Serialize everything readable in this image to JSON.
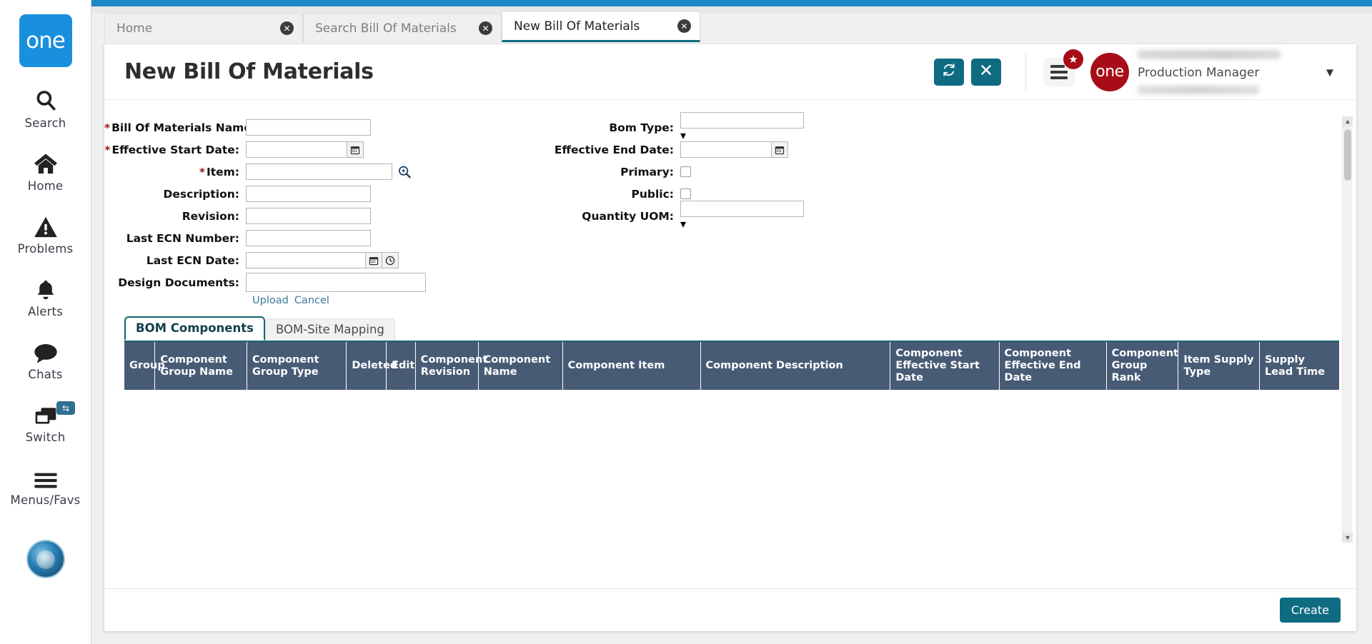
{
  "rail": {
    "logo_text": "one",
    "items": [
      {
        "label": "Search",
        "icon": "search-icon"
      },
      {
        "label": "Home",
        "icon": "home-icon"
      },
      {
        "label": "Problems",
        "icon": "warning-icon"
      },
      {
        "label": "Alerts",
        "icon": "bell-icon"
      },
      {
        "label": "Chats",
        "icon": "chat-bubble-icon"
      },
      {
        "label": "Switch",
        "icon": "switch-windows-icon",
        "badge_icon": "swap-arrows-icon"
      },
      {
        "label": "Menus/Favs",
        "icon": "hamburger-icon"
      }
    ]
  },
  "tabs": [
    {
      "label": "Home",
      "active": false
    },
    {
      "label": "Search Bill Of Materials",
      "active": false
    },
    {
      "label": "New Bill Of Materials",
      "active": true
    }
  ],
  "header": {
    "title": "New Bill Of Materials",
    "refresh_icon": "refresh-icon",
    "close_icon": "close-icon",
    "menu_icon": "hamburger-menu-icon",
    "menu_badge_icon": "star-icon",
    "brand_mark": "one",
    "user_role": "Production Manager",
    "user_caret_icon": "chevron-down-icon"
  },
  "form": {
    "left": [
      {
        "label": "Bill Of Materials Name:",
        "required": true,
        "type": "text",
        "value": "",
        "name": "bill-of-materials-name"
      },
      {
        "label": "Effective Start Date:",
        "required": true,
        "type": "date",
        "value": "",
        "name": "effective-start-date",
        "icon": "calendar-icon"
      },
      {
        "label": "Item:",
        "required": true,
        "type": "lookup",
        "value": "",
        "name": "item",
        "icon": "magnifier-icon"
      },
      {
        "label": "Description:",
        "required": false,
        "type": "text",
        "value": "",
        "name": "description"
      },
      {
        "label": "Revision:",
        "required": false,
        "type": "text",
        "value": "",
        "name": "revision"
      },
      {
        "label": "Last ECN Number:",
        "required": false,
        "type": "text",
        "value": "",
        "name": "last-ecn-number"
      },
      {
        "label": "Last ECN Date:",
        "required": false,
        "type": "datetime",
        "value": "",
        "name": "last-ecn-date",
        "icon": "calendar-icon",
        "icon2": "clock-icon"
      },
      {
        "label": "Design Documents:",
        "required": false,
        "type": "file",
        "value": "",
        "name": "design-documents"
      }
    ],
    "upload_label": "Upload",
    "cancel_label": "Cancel",
    "right": [
      {
        "label": "Bom Type:",
        "required": false,
        "type": "select",
        "value": "",
        "name": "bom-type",
        "icon": "chevron-down-icon"
      },
      {
        "label": "Effective End Date:",
        "required": false,
        "type": "date",
        "value": "",
        "name": "effective-end-date",
        "icon": "calendar-icon"
      },
      {
        "label": "Primary:",
        "required": false,
        "type": "checkbox",
        "checked": false,
        "name": "primary"
      },
      {
        "label": "Public:",
        "required": false,
        "type": "checkbox",
        "checked": false,
        "name": "public"
      },
      {
        "label": "Quantity UOM:",
        "required": false,
        "type": "select",
        "value": "",
        "name": "quantity-uom",
        "icon": "chevron-down-icon"
      }
    ]
  },
  "subtabs": [
    {
      "label": "BOM Components",
      "active": true
    },
    {
      "label": "BOM-Site Mapping",
      "active": false
    }
  ],
  "grid": {
    "columns": [
      "Group",
      "Component Group Name",
      "Component Group Type",
      "Deleted",
      "Edit",
      "Component Revision",
      "Component Name",
      "Component Item",
      "Component Description",
      "Component Effective Start Date",
      "Component Effective End Date",
      "Component Group Rank",
      "Item Supply Type",
      "Supply Lead Time"
    ],
    "rows": []
  },
  "footer": {
    "create_label": "Create"
  },
  "colors": {
    "accent_teal": "#0e6b82",
    "brand_blue": "#1a8fdd",
    "brand_red": "#a80c18",
    "grid_header": "#475b75",
    "required_star": "#9b1616"
  }
}
